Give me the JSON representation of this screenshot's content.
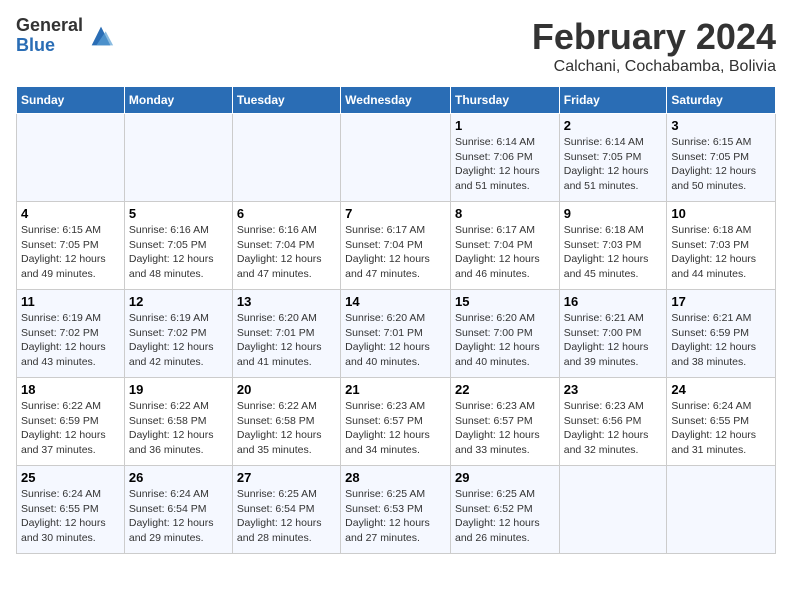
{
  "header": {
    "logo_general": "General",
    "logo_blue": "Blue",
    "month_title": "February 2024",
    "location": "Calchani, Cochabamba, Bolivia"
  },
  "days_of_week": [
    "Sunday",
    "Monday",
    "Tuesday",
    "Wednesday",
    "Thursday",
    "Friday",
    "Saturday"
  ],
  "weeks": [
    [
      {
        "day": "",
        "info": ""
      },
      {
        "day": "",
        "info": ""
      },
      {
        "day": "",
        "info": ""
      },
      {
        "day": "",
        "info": ""
      },
      {
        "day": "1",
        "info": "Sunrise: 6:14 AM\nSunset: 7:06 PM\nDaylight: 12 hours\nand 51 minutes."
      },
      {
        "day": "2",
        "info": "Sunrise: 6:14 AM\nSunset: 7:05 PM\nDaylight: 12 hours\nand 51 minutes."
      },
      {
        "day": "3",
        "info": "Sunrise: 6:15 AM\nSunset: 7:05 PM\nDaylight: 12 hours\nand 50 minutes."
      }
    ],
    [
      {
        "day": "4",
        "info": "Sunrise: 6:15 AM\nSunset: 7:05 PM\nDaylight: 12 hours\nand 49 minutes."
      },
      {
        "day": "5",
        "info": "Sunrise: 6:16 AM\nSunset: 7:05 PM\nDaylight: 12 hours\nand 48 minutes."
      },
      {
        "day": "6",
        "info": "Sunrise: 6:16 AM\nSunset: 7:04 PM\nDaylight: 12 hours\nand 47 minutes."
      },
      {
        "day": "7",
        "info": "Sunrise: 6:17 AM\nSunset: 7:04 PM\nDaylight: 12 hours\nand 47 minutes."
      },
      {
        "day": "8",
        "info": "Sunrise: 6:17 AM\nSunset: 7:04 PM\nDaylight: 12 hours\nand 46 minutes."
      },
      {
        "day": "9",
        "info": "Sunrise: 6:18 AM\nSunset: 7:03 PM\nDaylight: 12 hours\nand 45 minutes."
      },
      {
        "day": "10",
        "info": "Sunrise: 6:18 AM\nSunset: 7:03 PM\nDaylight: 12 hours\nand 44 minutes."
      }
    ],
    [
      {
        "day": "11",
        "info": "Sunrise: 6:19 AM\nSunset: 7:02 PM\nDaylight: 12 hours\nand 43 minutes."
      },
      {
        "day": "12",
        "info": "Sunrise: 6:19 AM\nSunset: 7:02 PM\nDaylight: 12 hours\nand 42 minutes."
      },
      {
        "day": "13",
        "info": "Sunrise: 6:20 AM\nSunset: 7:01 PM\nDaylight: 12 hours\nand 41 minutes."
      },
      {
        "day": "14",
        "info": "Sunrise: 6:20 AM\nSunset: 7:01 PM\nDaylight: 12 hours\nand 40 minutes."
      },
      {
        "day": "15",
        "info": "Sunrise: 6:20 AM\nSunset: 7:00 PM\nDaylight: 12 hours\nand 40 minutes."
      },
      {
        "day": "16",
        "info": "Sunrise: 6:21 AM\nSunset: 7:00 PM\nDaylight: 12 hours\nand 39 minutes."
      },
      {
        "day": "17",
        "info": "Sunrise: 6:21 AM\nSunset: 6:59 PM\nDaylight: 12 hours\nand 38 minutes."
      }
    ],
    [
      {
        "day": "18",
        "info": "Sunrise: 6:22 AM\nSunset: 6:59 PM\nDaylight: 12 hours\nand 37 minutes."
      },
      {
        "day": "19",
        "info": "Sunrise: 6:22 AM\nSunset: 6:58 PM\nDaylight: 12 hours\nand 36 minutes."
      },
      {
        "day": "20",
        "info": "Sunrise: 6:22 AM\nSunset: 6:58 PM\nDaylight: 12 hours\nand 35 minutes."
      },
      {
        "day": "21",
        "info": "Sunrise: 6:23 AM\nSunset: 6:57 PM\nDaylight: 12 hours\nand 34 minutes."
      },
      {
        "day": "22",
        "info": "Sunrise: 6:23 AM\nSunset: 6:57 PM\nDaylight: 12 hours\nand 33 minutes."
      },
      {
        "day": "23",
        "info": "Sunrise: 6:23 AM\nSunset: 6:56 PM\nDaylight: 12 hours\nand 32 minutes."
      },
      {
        "day": "24",
        "info": "Sunrise: 6:24 AM\nSunset: 6:55 PM\nDaylight: 12 hours\nand 31 minutes."
      }
    ],
    [
      {
        "day": "25",
        "info": "Sunrise: 6:24 AM\nSunset: 6:55 PM\nDaylight: 12 hours\nand 30 minutes."
      },
      {
        "day": "26",
        "info": "Sunrise: 6:24 AM\nSunset: 6:54 PM\nDaylight: 12 hours\nand 29 minutes."
      },
      {
        "day": "27",
        "info": "Sunrise: 6:25 AM\nSunset: 6:54 PM\nDaylight: 12 hours\nand 28 minutes."
      },
      {
        "day": "28",
        "info": "Sunrise: 6:25 AM\nSunset: 6:53 PM\nDaylight: 12 hours\nand 27 minutes."
      },
      {
        "day": "29",
        "info": "Sunrise: 6:25 AM\nSunset: 6:52 PM\nDaylight: 12 hours\nand 26 minutes."
      },
      {
        "day": "",
        "info": ""
      },
      {
        "day": "",
        "info": ""
      }
    ]
  ]
}
